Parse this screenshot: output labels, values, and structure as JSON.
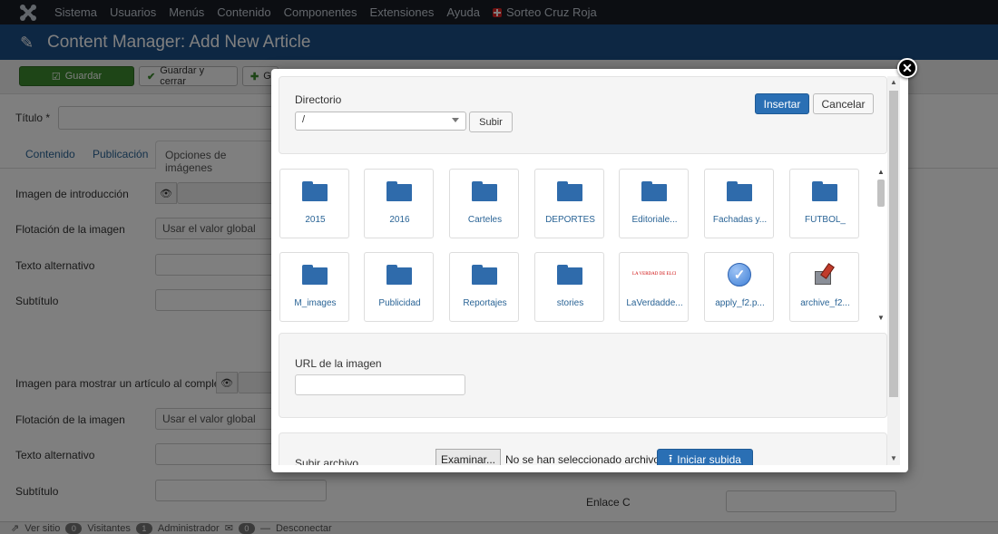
{
  "topnav": {
    "items": [
      "Sistema",
      "Usuarios",
      "Menús",
      "Contenido",
      "Componentes",
      "Extensiones",
      "Ayuda"
    ],
    "sorteo": "Sorteo Cruz Roja"
  },
  "header": {
    "title": "Content Manager: Add New Article"
  },
  "toolbar": {
    "guardar": "Guardar",
    "guardar_cerrar": "Guardar y cerrar",
    "plus": "G"
  },
  "form": {
    "titulo_label": "Título *",
    "tabs": [
      "Contenido",
      "Publicación",
      "Opciones de imágenes"
    ],
    "intro_image_label": "Imagen de introducción",
    "flotacion_label": "Flotación de la imagen",
    "flotacion_value": "Usar el valor global",
    "texto_alt_label": "Texto alternativo",
    "subtitulo_label": "Subtítulo",
    "full_image_label": "Imagen para mostrar un artículo al completo",
    "flotacion2_label": "Flotación de la imagen",
    "flotacion2_value": "Usar el valor global",
    "texto_alt2_label": "Texto alternativo",
    "subtitulo2_label": "Subtítulo",
    "enlace_c_label": "Enlace C"
  },
  "statusbar": {
    "ver_sitio": "Ver sitio",
    "visitantes_count": "0",
    "visitantes": "Visitantes",
    "admin_count": "1",
    "administrador": "Administrador",
    "mensajes_count": "0",
    "desconectar": "Desconectar"
  },
  "modal": {
    "directorio_label": "Directorio",
    "directorio_value": "/",
    "subir": "Subir",
    "insertar": "Insertar",
    "cancelar": "Cancelar",
    "url_label": "URL de la imagen",
    "url_value": "",
    "subir_archivo_label": "Subir archivo",
    "examinar": "Examinar...",
    "no_file": "No se han seleccionado archivos.",
    "iniciar_subida": "Iniciar subida",
    "items": [
      {
        "label": "2015",
        "type": "folder"
      },
      {
        "label": "2016",
        "type": "folder"
      },
      {
        "label": "Carteles",
        "type": "folder"
      },
      {
        "label": "DEPORTES",
        "type": "folder"
      },
      {
        "label": "Editoriale...",
        "type": "folder"
      },
      {
        "label": "Fachadas y...",
        "type": "folder"
      },
      {
        "label": "FÚTBOL_",
        "type": "folder"
      },
      {
        "label": "M_images",
        "type": "folder"
      },
      {
        "label": "Publicidad",
        "type": "folder"
      },
      {
        "label": "Reportajes",
        "type": "folder"
      },
      {
        "label": "stories",
        "type": "folder"
      },
      {
        "label": "LaVerdadde...",
        "type": "image-thumb",
        "thumb_text": "LA VERDAD DE ELCHE"
      },
      {
        "label": "apply_f2.p...",
        "type": "apply-icon"
      },
      {
        "label": "archive_f2...",
        "type": "archive-icon"
      }
    ]
  }
}
